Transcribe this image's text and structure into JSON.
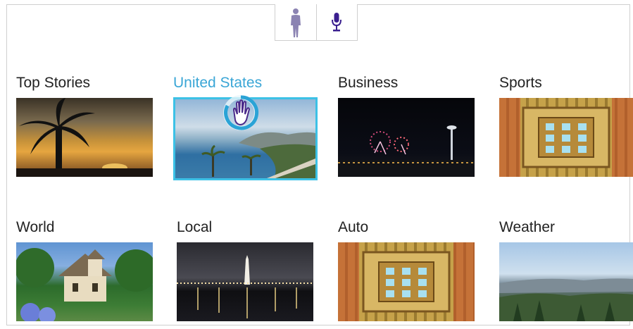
{
  "toolbar": {
    "buttons": [
      {
        "icon": "person-silhouette-icon"
      },
      {
        "icon": "microphone-icon"
      }
    ]
  },
  "accent_color": "#3aa6d6",
  "selection_color": "#3cc1e6",
  "categories": [
    {
      "label": "Top Stories"
    },
    {
      "label": "United States"
    },
    {
      "label": "Business"
    },
    {
      "label": "Sports"
    },
    {
      "label": "World"
    },
    {
      "label": "Local"
    },
    {
      "label": "Auto"
    },
    {
      "label": "Weather"
    }
  ]
}
